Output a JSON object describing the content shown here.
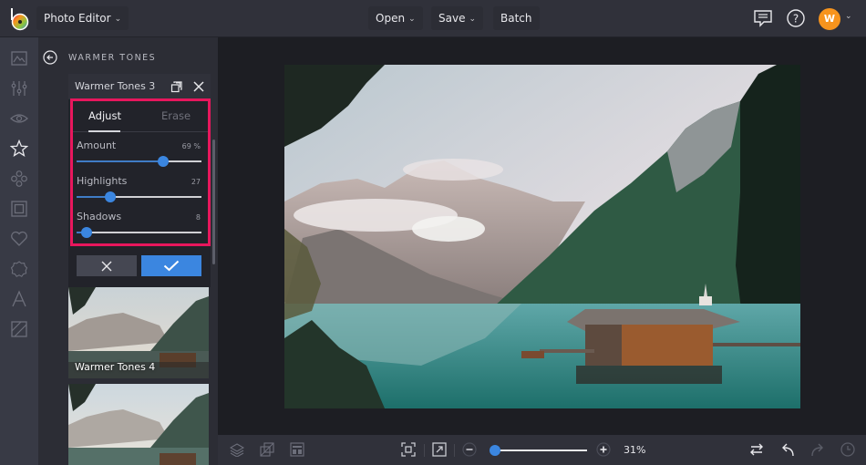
{
  "topbar": {
    "app_menu_label": "Photo Editor",
    "open_label": "Open",
    "save_label": "Save",
    "batch_label": "Batch",
    "avatar_initial": "W",
    "icons": [
      "comments-icon",
      "help-icon"
    ]
  },
  "rail": {
    "items": [
      "image-icon",
      "sliders-icon",
      "eye-icon",
      "star-icon",
      "flower-icon",
      "frame-icon",
      "heart-icon",
      "badge-icon",
      "text-icon",
      "texture-icon"
    ],
    "active": "star-icon"
  },
  "panel": {
    "title": "WARMER TONES",
    "card": {
      "title": "Warmer Tones 3",
      "tabs": [
        {
          "label": "Adjust",
          "active": true
        },
        {
          "label": "Erase",
          "active": false
        }
      ],
      "sliders": [
        {
          "label": "Amount",
          "value_text": "69 %",
          "value": 69,
          "max": 100
        },
        {
          "label": "Highlights",
          "value_text": "27",
          "value": 27,
          "max": 100
        },
        {
          "label": "Shadows",
          "value_text": "8",
          "value": 8,
          "max": 100
        }
      ]
    },
    "thumbnails": [
      {
        "label": "Warmer Tones 4"
      },
      {
        "label": ""
      }
    ]
  },
  "bottombar": {
    "zoom_percent_text": "31%",
    "zoom_fraction": 0.03,
    "icons": [
      "layers-icon",
      "crop-overlay-icon",
      "layout-icon",
      "fit-screen-icon",
      "actual-size-icon",
      "zoom-out-icon",
      "zoom-in-icon",
      "compare-icon",
      "undo-icon",
      "redo-icon",
      "history-icon"
    ]
  },
  "colors": {
    "accent": "#3b86e0",
    "highlight_border": "#e8175d",
    "avatar": "#f7941d"
  }
}
